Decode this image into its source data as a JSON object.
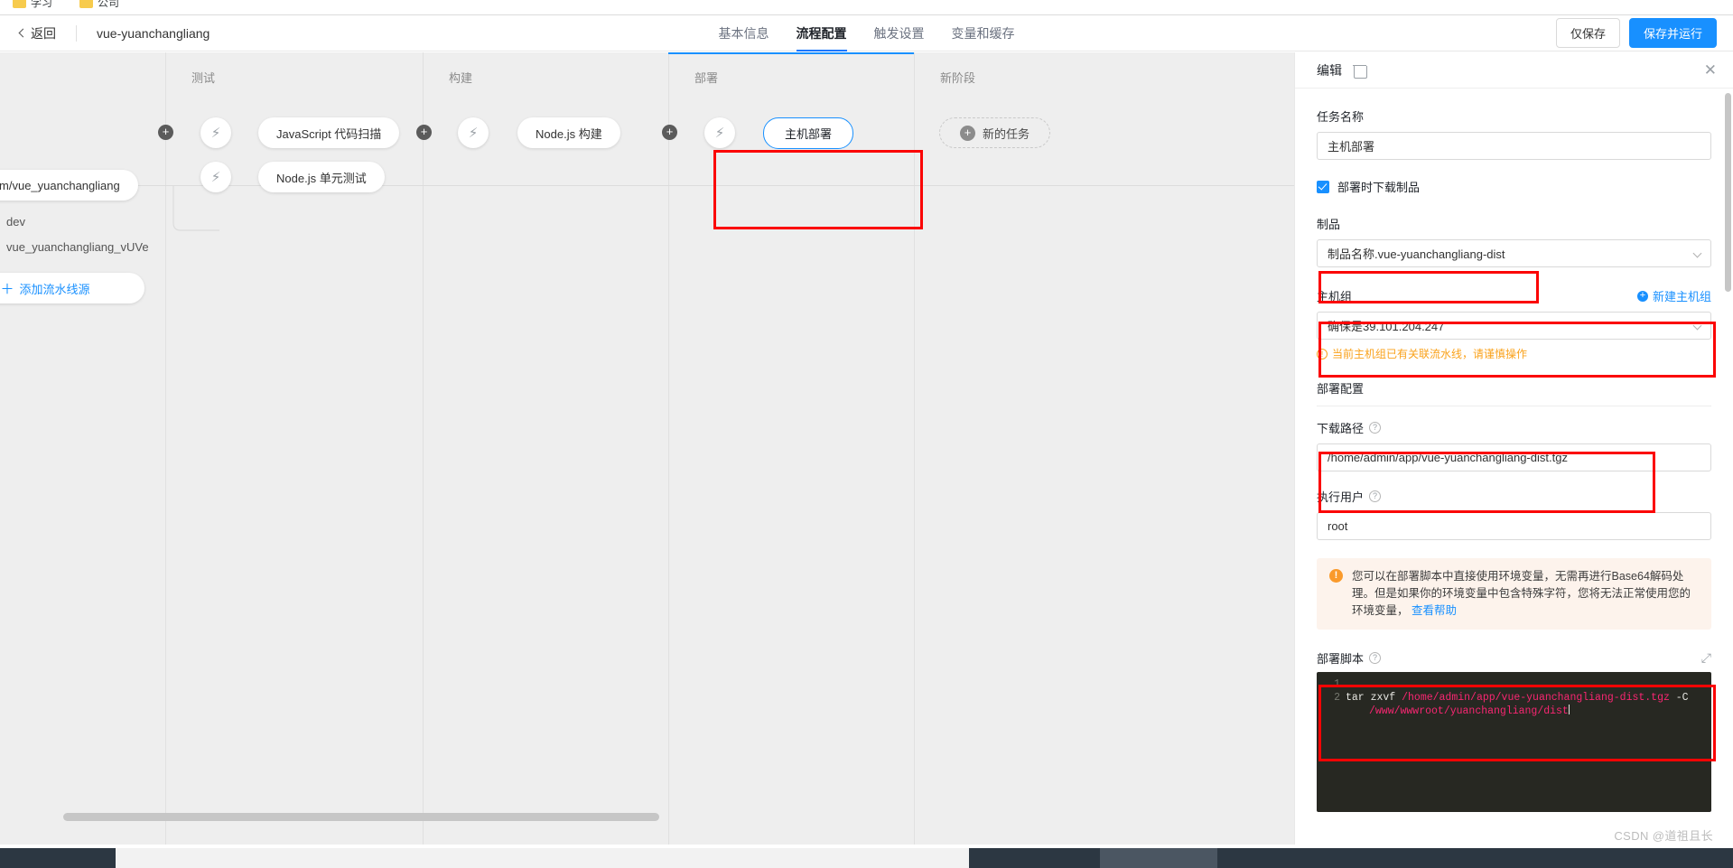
{
  "browser": {
    "bookmarks": [
      {
        "label": "学习",
        "icon": "folder-icon"
      },
      {
        "label": "公司",
        "icon": "folder-icon"
      }
    ]
  },
  "topbar": {
    "back_label": "返回",
    "back_icon": "chevron-left-icon",
    "project_name": "vue-yuanchangliang",
    "tabs": [
      {
        "label": "基本信息",
        "active": false
      },
      {
        "label": "流程配置",
        "active": true
      },
      {
        "label": "触发设置",
        "active": false
      },
      {
        "label": "变量和缓存",
        "active": false
      }
    ],
    "save_only_label": "仅保存",
    "save_run_label": "保存并运行",
    "primary_color": "#1890ff"
  },
  "canvas": {
    "source": {
      "repo_label": "ebymom/vue_yuanchangliang",
      "branch": "dev",
      "artifact": "vue_yuanchangliang_vUVe",
      "add_source_label": "添加流水线源",
      "add_source_icon": "plus-icon"
    },
    "stages": [
      {
        "title": "测试",
        "nodes": [
          {
            "label": "JavaScript 代码扫描",
            "icon": "bolt-icon",
            "selected": false
          },
          {
            "label": "Node.js 单元测试",
            "icon": "bolt-icon",
            "selected": false
          }
        ]
      },
      {
        "title": "构建",
        "nodes": [
          {
            "label": "Node.js 构建",
            "icon": "bolt-icon",
            "selected": false
          }
        ]
      },
      {
        "title": "部署",
        "nodes": [
          {
            "label": "主机部署",
            "icon": "bolt-icon",
            "selected": true
          }
        ]
      },
      {
        "title": "新阶段",
        "nodes": [],
        "new_task_label": "新的任务",
        "new_task_icon": "plus-circle-icon"
      }
    ]
  },
  "panel": {
    "title": "编辑",
    "delete_icon": "trash-icon",
    "close_icon": "close-icon",
    "task_name_label": "任务名称",
    "task_name_value": "主机部署",
    "download_artifact_label": "部署时下载制品",
    "download_artifact_checked": true,
    "artifact_label": "制品",
    "artifact_value": "制品名称.vue-yuanchangliang-dist",
    "hostgroup_label": "主机组",
    "hostgroup_new_label": "新建主机组",
    "hostgroup_new_icon": "plus-circle-icon",
    "hostgroup_value": "确保是39.101.204.247",
    "hostgroup_warning": "当前主机组已有关联流水线，请谨慎操作",
    "deploy_config_label": "部署配置",
    "download_path_label": "下载路径",
    "download_path_value": "/home/admin/app/vue-yuanchangliang-dist.tgz",
    "exec_user_label": "执行用户",
    "exec_user_value": "root",
    "alert_icon": "warning-icon",
    "alert_text": "您可以在部署脚本中直接使用环境变量，无需再进行Base64解码处理。但是如果你的环境变量中包含特殊字符，您将无法正常使用您的环境变量，",
    "alert_link": "查看帮助",
    "deploy_script_label": "部署脚本",
    "expand_icon": "expand-icon",
    "help_icon": "question-icon",
    "script_lines": [
      {
        "no": "1",
        "text": ""
      },
      {
        "no": "2",
        "cmd": "tar zxvf ",
        "path1": "/home/admin/app/vue-yuanchangliang-dist.tgz",
        "flag": " -C",
        "path2": "/www/wwwroot/yuanchangliang/dist"
      }
    ]
  },
  "watermark": "CSDN @道祖且长",
  "annotation": {
    "highlight_color": "#fb0404",
    "boxes": [
      "deploy-stage-node",
      "artifact-select",
      "hostgroup-section",
      "download-path-field",
      "deploy-script-editor"
    ]
  }
}
